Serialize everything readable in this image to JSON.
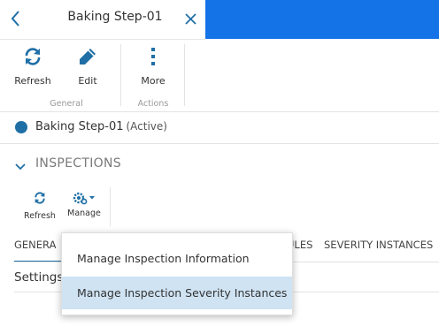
{
  "header": {
    "title": "Baking Step-01",
    "accent_color": "#1473e6",
    "back_icon": "chevron-left-icon",
    "close_icon": "close-icon"
  },
  "toolbar": {
    "general": {
      "label": "General",
      "refresh_label": "Refresh",
      "edit_label": "Edit"
    },
    "actions": {
      "label": "Actions",
      "more_label": "More"
    }
  },
  "record": {
    "name": "Baking Step-01",
    "state": "(Active)",
    "status_color": "#1f6fa6"
  },
  "section": {
    "title": "INSPECTIONS",
    "refresh_label": "Refresh",
    "manage_label": "Manage"
  },
  "tabs": [
    {
      "label": "GENERA"
    },
    {
      "label": "ULES"
    },
    {
      "label": "SEVERITY INSTANCES"
    }
  ],
  "settings_label": "Settings",
  "manage_menu": {
    "items": [
      {
        "label": "Manage Inspection Information",
        "highlighted": false
      },
      {
        "label": "Manage Inspection Severity Instances",
        "highlighted": true
      }
    ]
  }
}
